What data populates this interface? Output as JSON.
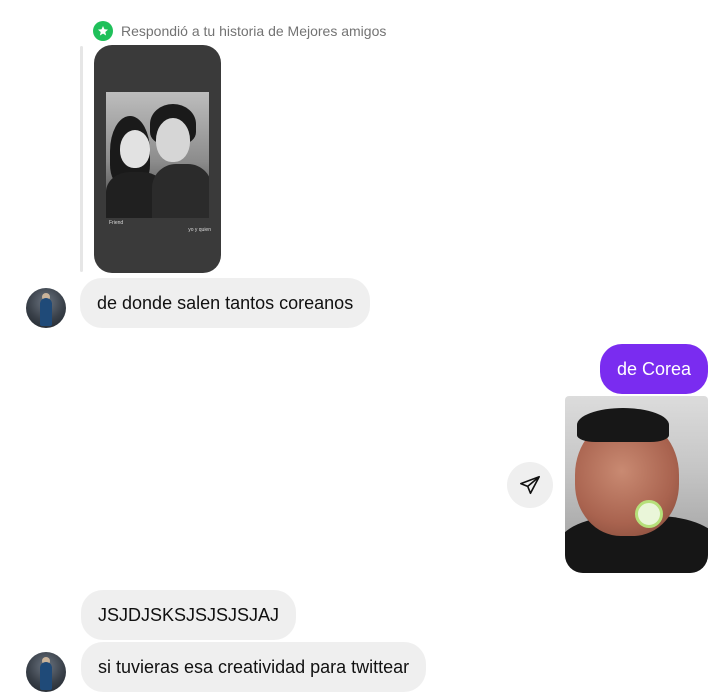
{
  "reply_context": {
    "label": "Respondió a tu historia de Mejores amigos",
    "badge_color": "#1fc05a",
    "story_caption_left": "Friend",
    "story_caption_right": "yo y quien"
  },
  "messages": {
    "incoming_1": "de donde salen tantos coreanos",
    "outgoing_1": "de Corea",
    "incoming_2": "JSJDJSKSJSJSJSJAJ",
    "incoming_3": "si tuvieras esa creatividad para twittear"
  },
  "colors": {
    "outgoing_bubble": "#7a2cf0",
    "incoming_bubble": "#efefef",
    "badge": "#1fc05a"
  },
  "icons": {
    "badge": "star-icon",
    "share": "paper-plane-icon"
  }
}
